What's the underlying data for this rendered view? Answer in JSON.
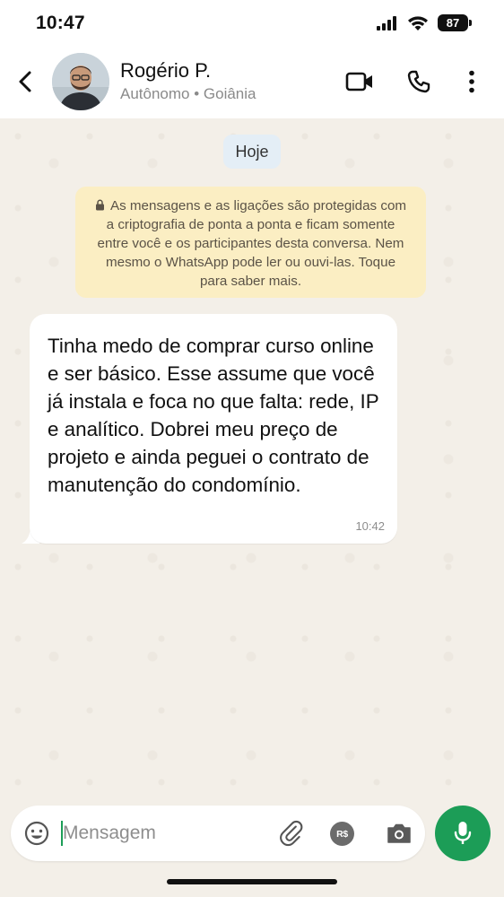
{
  "status_bar": {
    "time": "10:47",
    "battery": "87",
    "icons": [
      "signal-icon",
      "wifi-icon",
      "battery-icon"
    ]
  },
  "header": {
    "contact_name": "Rogério P.",
    "contact_status": "Autônomo • Goiânia",
    "icons": [
      "back-arrow-icon",
      "video-call-icon",
      "phone-icon",
      "more-vertical-icon"
    ]
  },
  "chat": {
    "date_label": "Hoje",
    "encryption_notice": "As mensagens e as ligações são protegidas com a criptografia de ponta a ponta e ficam somente entre você e os participantes desta conversa. Nem mesmo o WhatsApp pode ler ou ouvi-las. Toque para saber mais.",
    "messages": [
      {
        "direction": "incoming",
        "text": "Tinha medo de comprar curso online e ser básico. Esse assume que você já instala e foca no que falta: rede, IP e analítico. Dobrei meu preço de projeto e ainda peguei o contrato de manutenção do condomínio.",
        "time": "10:42"
      }
    ]
  },
  "input_bar": {
    "placeholder": "Mensagem",
    "value": "",
    "payment_label": "R$",
    "icons": [
      "emoji-icon",
      "attach-icon",
      "payment-icon",
      "camera-icon",
      "mic-icon"
    ]
  },
  "colors": {
    "accent": "#1c9d57",
    "chat_background": "#f3efe8",
    "notice_background": "#fbeec3",
    "date_pill": "#e4eef6"
  }
}
